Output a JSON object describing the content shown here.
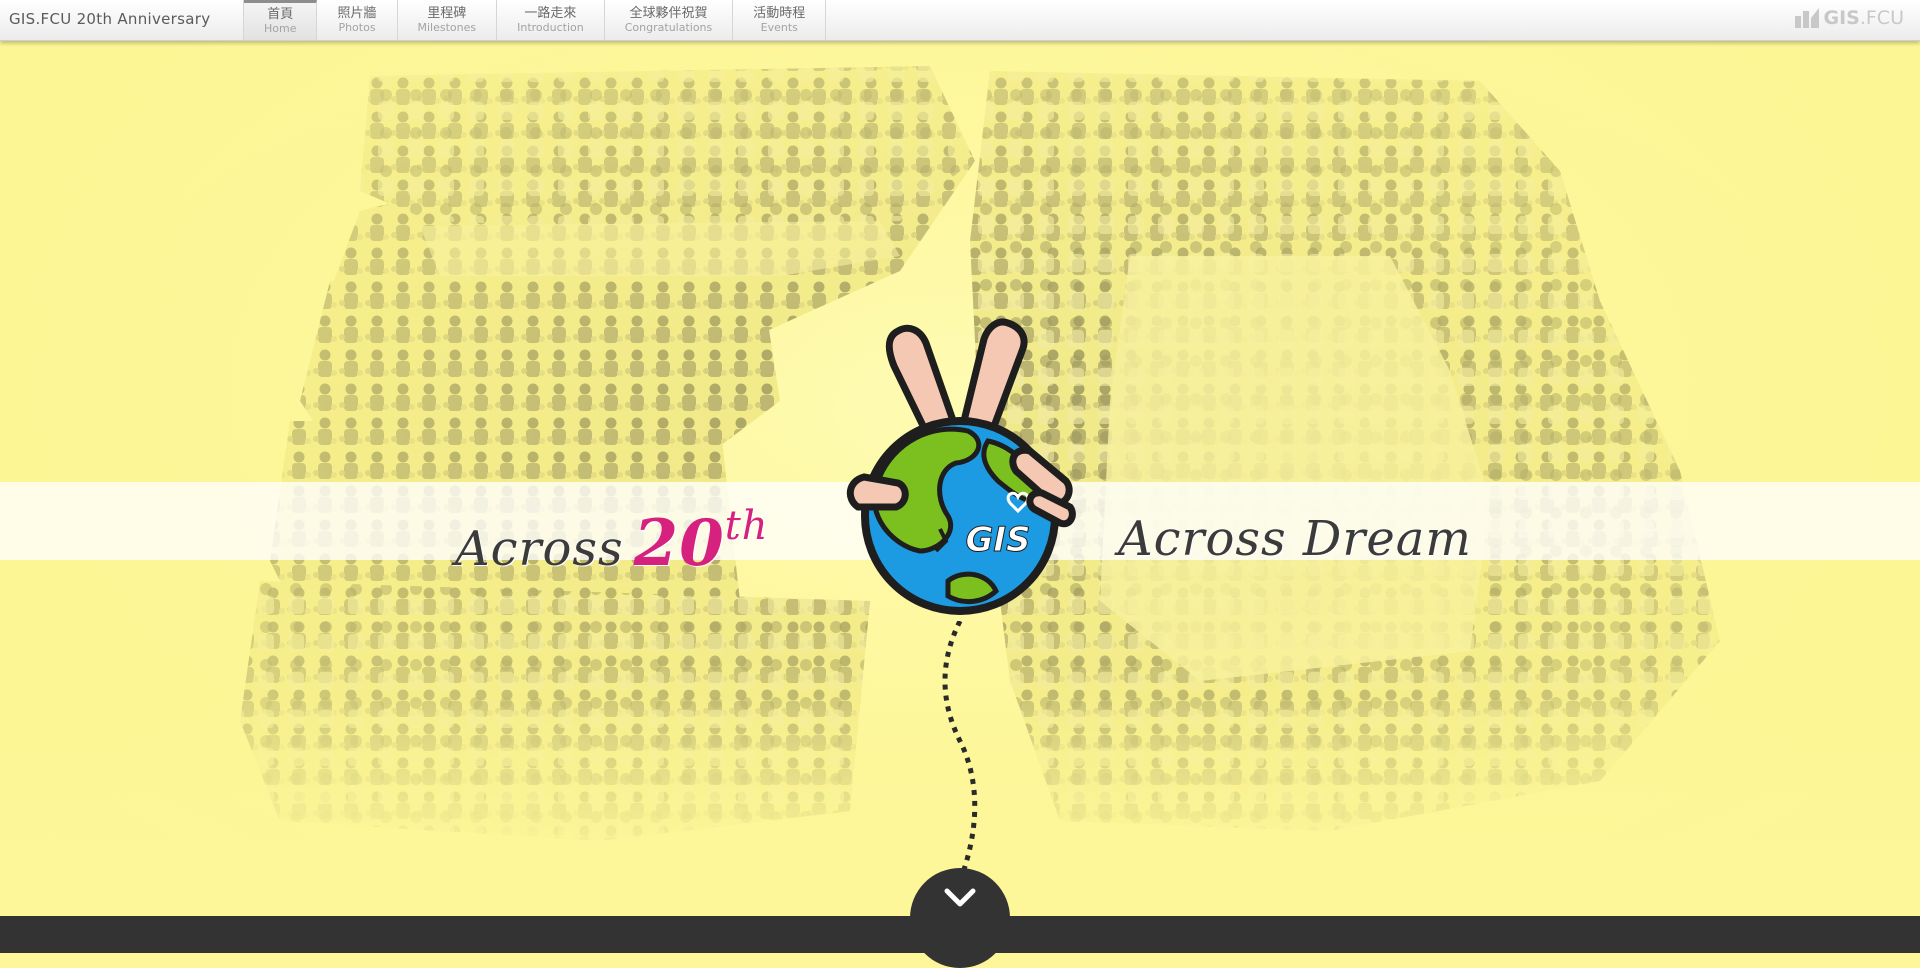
{
  "site_title": "GIS.FCU 20th Anniversary",
  "nav": {
    "items": [
      {
        "zh": "首頁",
        "en": "Home",
        "active": true
      },
      {
        "zh": "照片牆",
        "en": "Photos",
        "active": false
      },
      {
        "zh": "里程碑",
        "en": "Milestones",
        "active": false
      },
      {
        "zh": "一路走來",
        "en": "Introduction",
        "active": false
      },
      {
        "zh": "全球夥伴祝賀",
        "en": "Congratulations",
        "active": false
      },
      {
        "zh": "活動時程",
        "en": "Events",
        "active": false
      }
    ]
  },
  "brand": {
    "bold": "GIS",
    "thin": ".FCU",
    "icon": "gis-fcu-logo-icon"
  },
  "hero": {
    "tagline_left": "Across",
    "tagline_number": "20",
    "tagline_suffix": "th",
    "tagline_right": "Across Dream",
    "logo_text": "GIS",
    "logo_icon": "peace-hand-globe-icon"
  },
  "scroll_button": {
    "icon": "chevron-down-icon"
  },
  "colors": {
    "background": "#fdf79a",
    "accent_pink": "#d6217f",
    "text_dark": "#3b3b3b",
    "footer": "#333333"
  }
}
